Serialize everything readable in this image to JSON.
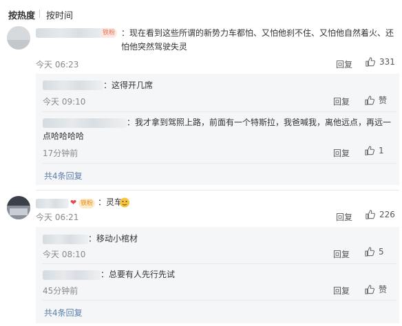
{
  "sort": {
    "hot": "按热度",
    "time": "按时间"
  },
  "comments": [
    {
      "badge": "铁粉",
      "text": "：现在看到这些所谓的新势力车都怕、又怕他刹不住、又怕他自然着火、还怕他突然驾驶失灵",
      "time": "今天 06:23",
      "reply": "回复",
      "likes": "331",
      "replies": [
        {
          "text": "：这得开几席",
          "time": "今天 09:10",
          "reply": "回复",
          "likes": "赞"
        },
        {
          "text": "：我才拿到驾照上路，前面有一个特斯拉，我爸喊我，离他远点，再远一点哈哈哈哈",
          "time": "17分钟前",
          "reply": "回复",
          "likes": "1"
        }
      ],
      "more": "共4条回复"
    },
    {
      "badge": "铁粉",
      "text": "：灵车",
      "time": "今天 06:21",
      "reply": "回复",
      "likes": "226",
      "replies": [
        {
          "text": "：移动小棺材",
          "time": "今天 08:10",
          "reply": "回复",
          "likes": "5"
        },
        {
          "text": "：总要有人先行先试",
          "time": "45分钟前",
          "reply": "回复",
          "likes": "赞"
        }
      ],
      "more": "共4条回复"
    }
  ],
  "colors": {
    "link": "#5a7fa9",
    "badge_red": "#e8734f",
    "badge_gold": "#e38b1b"
  }
}
